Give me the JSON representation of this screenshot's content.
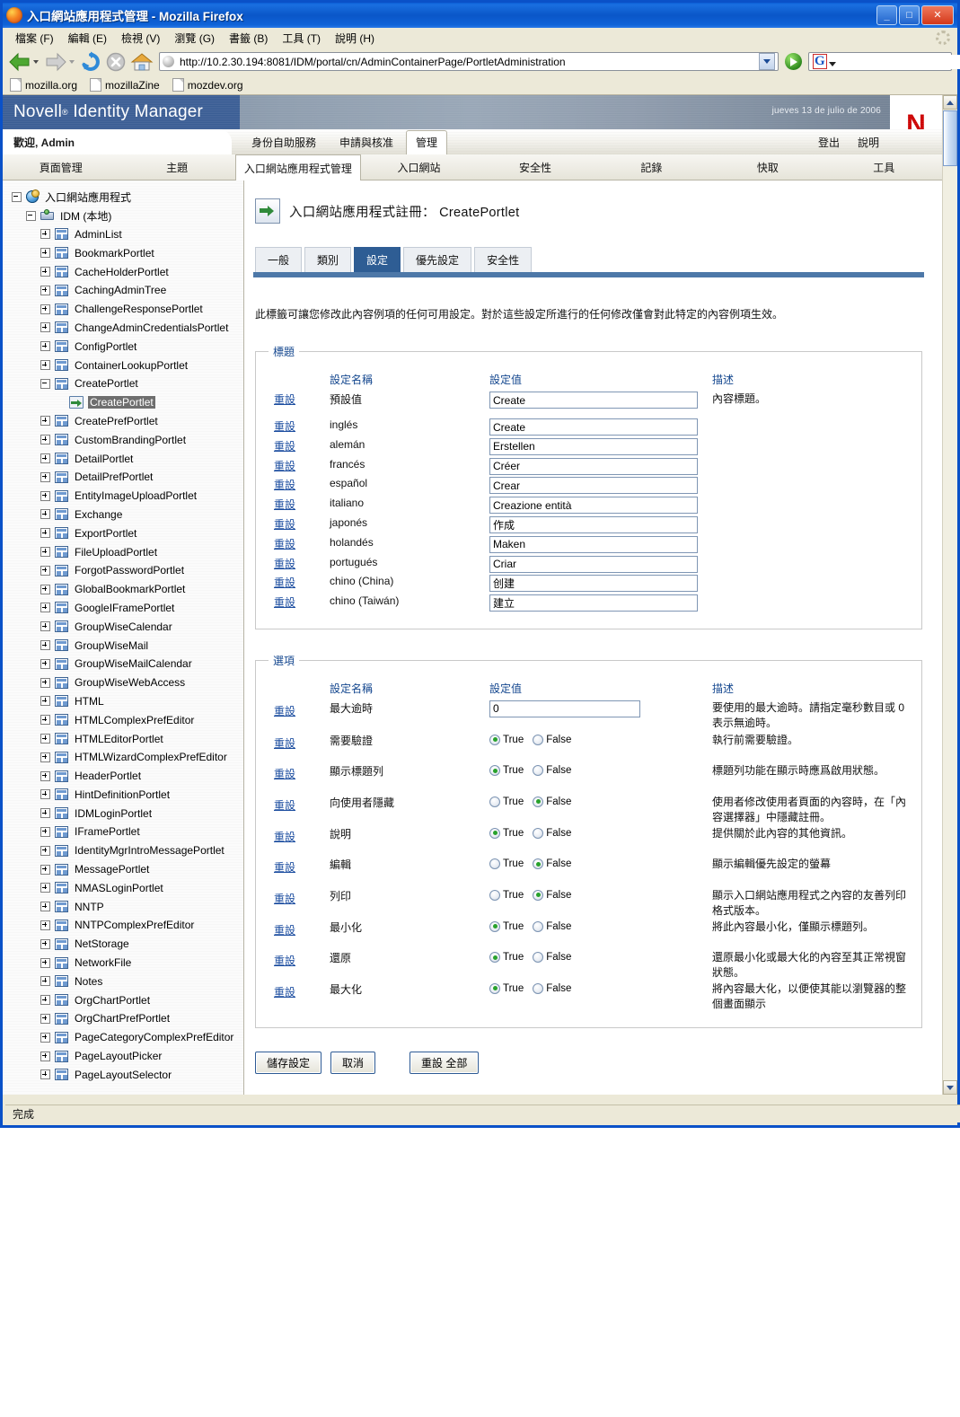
{
  "browser": {
    "window_title": "入口網站應用程式管理",
    "window_title_suffix": "- Mozilla Firefox",
    "window_buttons": {
      "minimize": "_",
      "maximize": "□",
      "close": "✕"
    },
    "menu": [
      {
        "label": "檔案 (F)"
      },
      {
        "label": "編輯 (E)"
      },
      {
        "label": "檢視 (V)"
      },
      {
        "label": "瀏覽 (G)"
      },
      {
        "label": "書籤 (B)"
      },
      {
        "label": "工具 (T)"
      },
      {
        "label": "說明 (H)"
      }
    ],
    "url": "http://10.2.30.194:8081/IDM/portal/cn/AdminContainerPage/PortletAdministration",
    "search_placeholder": "",
    "search_engine_glyph": "G",
    "bookmarks": [
      {
        "label": "mozilla.org"
      },
      {
        "label": "mozillaZine"
      },
      {
        "label": "mozdev.org"
      }
    ],
    "status": "完成"
  },
  "portal": {
    "product_name": "Novell",
    "product_reg": "®",
    "product_suite": "Identity Manager",
    "date": "jueves 13 de julio de 2006",
    "logo_letter": "N",
    "welcome": "歡迎, Admin",
    "top_tabs": [
      {
        "label": "身份自助服務",
        "active": false
      },
      {
        "label": "申請與核准",
        "active": false
      },
      {
        "label": "管理",
        "active": true
      }
    ],
    "top_links": [
      {
        "label": "登出"
      },
      {
        "label": "說明"
      }
    ],
    "sub_tabs": [
      {
        "label": "頁面管理",
        "active": false
      },
      {
        "label": "主題",
        "active": false
      },
      {
        "label": "入口網站應用程式管理",
        "active": true
      },
      {
        "label": "入口網站",
        "active": false
      },
      {
        "label": "安全性",
        "active": false
      },
      {
        "label": "記錄",
        "active": false
      },
      {
        "label": "快取",
        "active": false
      },
      {
        "label": "工具",
        "active": false
      }
    ]
  },
  "tree": [
    {
      "label": "入口網站應用程式",
      "level": 0,
      "expander": "minus",
      "icon": "globe"
    },
    {
      "label": "IDM (本地)",
      "level": 1,
      "expander": "minus",
      "icon": "server"
    },
    {
      "label": "AdminList",
      "level": 2,
      "expander": "plus",
      "icon": "portlet"
    },
    {
      "label": "BookmarkPortlet",
      "level": 2,
      "expander": "plus",
      "icon": "portlet"
    },
    {
      "label": "CacheHolderPortlet",
      "level": 2,
      "expander": "plus",
      "icon": "portlet"
    },
    {
      "label": "CachingAdminTree",
      "level": 2,
      "expander": "plus",
      "icon": "portlet"
    },
    {
      "label": "ChallengeResponsePortlet",
      "level": 2,
      "expander": "plus",
      "icon": "portlet"
    },
    {
      "label": "ChangeAdminCredentialsPortlet",
      "level": 2,
      "expander": "plus",
      "icon": "portlet"
    },
    {
      "label": "ConfigPortlet",
      "level": 2,
      "expander": "plus",
      "icon": "portlet"
    },
    {
      "label": "ContainerLookupPortlet",
      "level": 2,
      "expander": "plus",
      "icon": "portlet"
    },
    {
      "label": "CreatePortlet",
      "level": 2,
      "expander": "minus",
      "icon": "portlet"
    },
    {
      "label": "CreatePortlet",
      "level": 3,
      "expander": "none",
      "icon": "instance",
      "selected": true
    },
    {
      "label": "CreatePrefPortlet",
      "level": 2,
      "expander": "plus",
      "icon": "portlet"
    },
    {
      "label": "CustomBrandingPortlet",
      "level": 2,
      "expander": "plus",
      "icon": "portlet"
    },
    {
      "label": "DetailPortlet",
      "level": 2,
      "expander": "plus",
      "icon": "portlet"
    },
    {
      "label": "DetailPrefPortlet",
      "level": 2,
      "expander": "plus",
      "icon": "portlet"
    },
    {
      "label": "EntityImageUploadPortlet",
      "level": 2,
      "expander": "plus",
      "icon": "portlet"
    },
    {
      "label": "Exchange",
      "level": 2,
      "expander": "plus",
      "icon": "portlet"
    },
    {
      "label": "ExportPortlet",
      "level": 2,
      "expander": "plus",
      "icon": "portlet"
    },
    {
      "label": "FileUploadPortlet",
      "level": 2,
      "expander": "plus",
      "icon": "portlet"
    },
    {
      "label": "ForgotPasswordPortlet",
      "level": 2,
      "expander": "plus",
      "icon": "portlet"
    },
    {
      "label": "GlobalBookmarkPortlet",
      "level": 2,
      "expander": "plus",
      "icon": "portlet"
    },
    {
      "label": "GoogleIFramePortlet",
      "level": 2,
      "expander": "plus",
      "icon": "portlet"
    },
    {
      "label": "GroupWiseCalendar",
      "level": 2,
      "expander": "plus",
      "icon": "portlet"
    },
    {
      "label": "GroupWiseMail",
      "level": 2,
      "expander": "plus",
      "icon": "portlet"
    },
    {
      "label": "GroupWiseMailCalendar",
      "level": 2,
      "expander": "plus",
      "icon": "portlet"
    },
    {
      "label": "GroupWiseWebAccess",
      "level": 2,
      "expander": "plus",
      "icon": "portlet"
    },
    {
      "label": "HTML",
      "level": 2,
      "expander": "plus",
      "icon": "portlet"
    },
    {
      "label": "HTMLComplexPrefEditor",
      "level": 2,
      "expander": "plus",
      "icon": "portlet"
    },
    {
      "label": "HTMLEditorPortlet",
      "level": 2,
      "expander": "plus",
      "icon": "portlet"
    },
    {
      "label": "HTMLWizardComplexPrefEditor",
      "level": 2,
      "expander": "plus",
      "icon": "portlet"
    },
    {
      "label": "HeaderPortlet",
      "level": 2,
      "expander": "plus",
      "icon": "portlet"
    },
    {
      "label": "HintDefinitionPortlet",
      "level": 2,
      "expander": "plus",
      "icon": "portlet"
    },
    {
      "label": "IDMLoginPortlet",
      "level": 2,
      "expander": "plus",
      "icon": "portlet"
    },
    {
      "label": "IFramePortlet",
      "level": 2,
      "expander": "plus",
      "icon": "portlet"
    },
    {
      "label": "IdentityMgrIntroMessagePortlet",
      "level": 2,
      "expander": "plus",
      "icon": "portlet"
    },
    {
      "label": "MessagePortlet",
      "level": 2,
      "expander": "plus",
      "icon": "portlet"
    },
    {
      "label": "NMASLoginPortlet",
      "level": 2,
      "expander": "plus",
      "icon": "portlet"
    },
    {
      "label": "NNTP",
      "level": 2,
      "expander": "plus",
      "icon": "portlet"
    },
    {
      "label": "NNTPComplexPrefEditor",
      "level": 2,
      "expander": "plus",
      "icon": "portlet"
    },
    {
      "label": "NetStorage",
      "level": 2,
      "expander": "plus",
      "icon": "portlet"
    },
    {
      "label": "NetworkFile",
      "level": 2,
      "expander": "plus",
      "icon": "portlet"
    },
    {
      "label": "Notes",
      "level": 2,
      "expander": "plus",
      "icon": "portlet"
    },
    {
      "label": "OrgChartPortlet",
      "level": 2,
      "expander": "plus",
      "icon": "portlet"
    },
    {
      "label": "OrgChartPrefPortlet",
      "level": 2,
      "expander": "plus",
      "icon": "portlet"
    },
    {
      "label": "PageCategoryComplexPrefEditor",
      "level": 2,
      "expander": "plus",
      "icon": "portlet"
    },
    {
      "label": "PageLayoutPicker",
      "level": 2,
      "expander": "plus",
      "icon": "portlet"
    },
    {
      "label": "PageLayoutSelector",
      "level": 2,
      "expander": "plus",
      "icon": "portlet"
    }
  ],
  "main": {
    "page_title": "入口網站應用程式註冊： CreatePortlet",
    "tabs": [
      {
        "label": "一般",
        "active": false
      },
      {
        "label": "類別",
        "active": false
      },
      {
        "label": "設定",
        "active": true
      },
      {
        "label": "優先設定",
        "active": false
      },
      {
        "label": "安全性",
        "active": false
      }
    ],
    "intro": "此標籤可讓您修改此內容例項的任何可用設定。對於這些設定所進行的任何修改僅會對此特定的內容例項生效。",
    "columns": {
      "name": "設定名稱",
      "value": "設定值",
      "description": "描述"
    },
    "reset_label": "重設",
    "title_group": {
      "legend": "標題",
      "rows": [
        {
          "name": "預設值",
          "value": "Create",
          "description": "內容標題。"
        },
        {
          "name": "inglés",
          "value": "Create",
          "description": ""
        },
        {
          "name": "alemán",
          "value": "Erstellen",
          "description": ""
        },
        {
          "name": "francés",
          "value": "Créer",
          "description": ""
        },
        {
          "name": "español",
          "value": "Crear",
          "description": ""
        },
        {
          "name": "italiano",
          "value": "Creazione entità",
          "description": ""
        },
        {
          "name": "japonés",
          "value": "作成",
          "description": ""
        },
        {
          "name": "holandés",
          "value": "Maken",
          "description": ""
        },
        {
          "name": "portugués",
          "value": "Criar",
          "description": ""
        },
        {
          "name": "chino (China)",
          "value": "创建",
          "description": ""
        },
        {
          "name": "chino (Taiwán)",
          "value": "建立",
          "description": ""
        }
      ]
    },
    "options_group": {
      "legend": "選項",
      "radio_true": "True",
      "radio_false": "False",
      "rows": [
        {
          "name": "最大逾時",
          "type": "text",
          "value": "0",
          "description": "要使用的最大逾時。請指定毫秒數目或 0 表示無逾時。"
        },
        {
          "name": "需要驗證",
          "type": "radio",
          "value": true,
          "description": "執行前需要驗證。"
        },
        {
          "name": "顯示標題列",
          "type": "radio",
          "value": true,
          "description": "標題列功能在顯示時應爲啟用狀態。"
        },
        {
          "name": "向使用者隱藏",
          "type": "radio",
          "value": false,
          "description": "使用者修改使用者頁面的內容時，在「內容選擇器」中隱藏註冊。"
        },
        {
          "name": "說明",
          "type": "radio",
          "value": true,
          "description": "提供關於此內容的其他資訊。"
        },
        {
          "name": "編輯",
          "type": "radio",
          "value": false,
          "description": "顯示編輯優先設定的螢幕"
        },
        {
          "name": "列印",
          "type": "radio",
          "value": false,
          "description": "顯示入口網站應用程式之內容的友善列印格式版本。"
        },
        {
          "name": "最小化",
          "type": "radio",
          "value": true,
          "description": "將此內容最小化，僅顯示標題列。"
        },
        {
          "name": "還原",
          "type": "radio",
          "value": true,
          "description": "還原最小化或最大化的內容至其正常視窗狀態。"
        },
        {
          "name": "最大化",
          "type": "radio",
          "value": true,
          "description": "將內容最大化，以便使其能以瀏覽器的整個畫面顯示"
        }
      ]
    },
    "buttons": {
      "save": "儲存設定",
      "cancel": "取消",
      "reset_all": "重設 全部"
    }
  }
}
